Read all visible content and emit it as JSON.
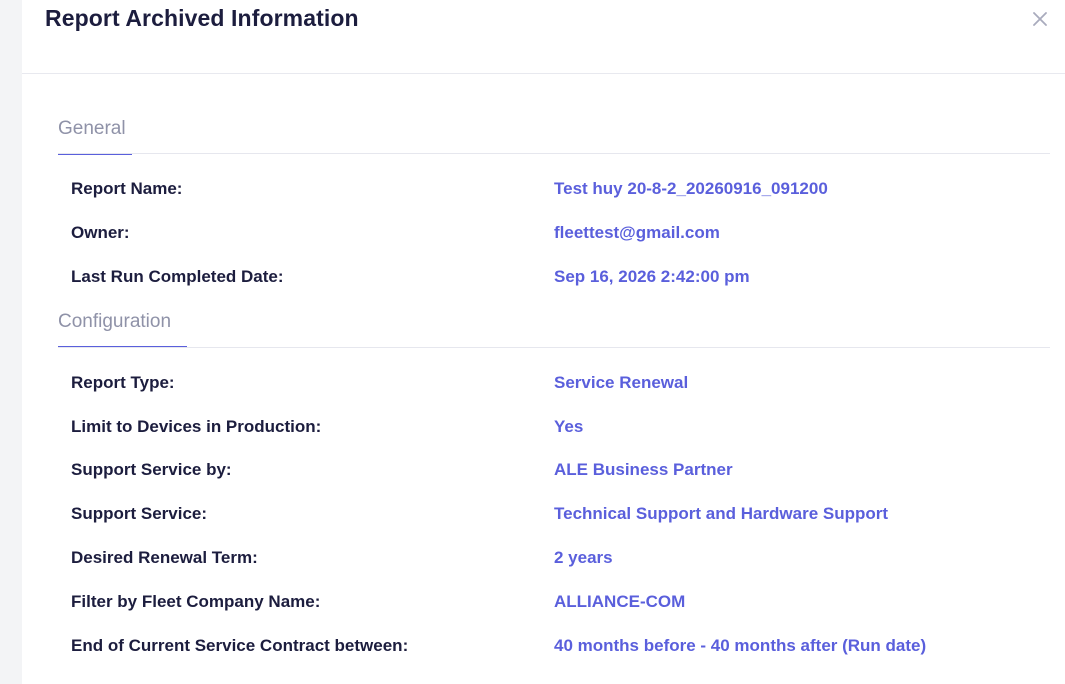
{
  "modal": {
    "title": "Report Archived Information"
  },
  "sections": [
    {
      "title": "General",
      "rows": [
        {
          "label": "Report Name:",
          "value": "Test huy 20-8-2_20260916_091200"
        },
        {
          "label": "Owner:",
          "value": "fleettest@gmail.com"
        },
        {
          "label": "Last Run Completed Date:",
          "value": "Sep 16, 2026 2:42:00 pm"
        }
      ]
    },
    {
      "title": "Configuration",
      "rows": [
        {
          "label": "Report Type:",
          "value": "Service Renewal"
        },
        {
          "label": "Limit to Devices in Production:",
          "value": "Yes"
        },
        {
          "label": "Support Service by:",
          "value": "ALE Business Partner"
        },
        {
          "label": "Support Service:",
          "value": "Technical Support and Hardware Support"
        },
        {
          "label": "Desired Renewal Term:",
          "value": "2 years"
        },
        {
          "label": "Filter by Fleet Company Name:",
          "value": "ALLIANCE-COM"
        },
        {
          "label": "End of Current Service Contract between:",
          "value": "40 months before - 40 months after (Run date)"
        }
      ]
    }
  ],
  "icons": {
    "close": "close-icon"
  },
  "colors": {
    "accent": "#5a5fdc",
    "text": "#1c1d3e",
    "muted": "#8f92a8"
  }
}
